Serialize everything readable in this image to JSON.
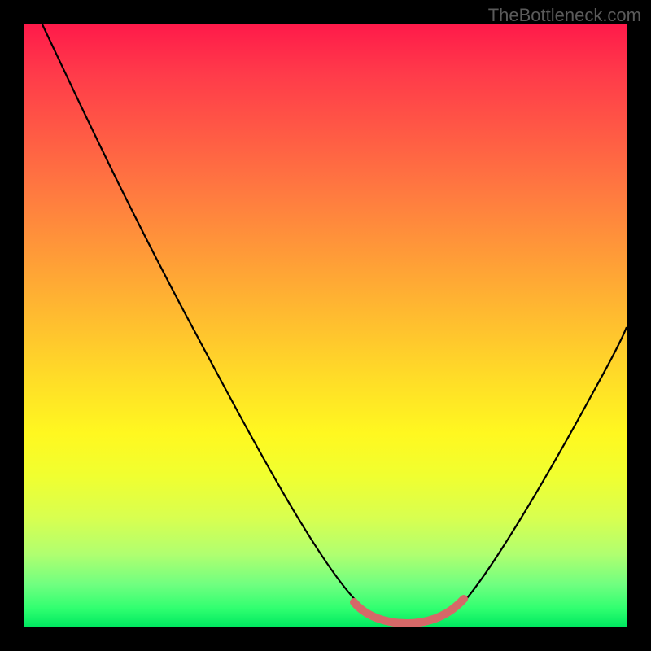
{
  "watermark": "TheBottleneck.com",
  "chart_data": {
    "type": "line",
    "title": "",
    "xlabel": "",
    "ylabel": "",
    "xlim": [
      0,
      100
    ],
    "ylim": [
      0,
      100
    ],
    "grid": false,
    "legend": false,
    "series": [
      {
        "name": "curve",
        "x": [
          3,
          10,
          20,
          30,
          40,
          50,
          55,
          58,
          60,
          63,
          66,
          70,
          73,
          78,
          85,
          92,
          100
        ],
        "y": [
          99,
          87,
          69,
          51,
          33,
          15,
          7,
          3,
          1,
          0,
          0,
          1,
          4,
          10,
          22,
          36,
          53
        ]
      }
    ],
    "accent_region": {
      "name": "highlighted-range",
      "x_start": 55,
      "x_end": 73,
      "color": "#d66868"
    },
    "gradient_stops": [
      {
        "pos": 0,
        "color": "#ff1a4a"
      },
      {
        "pos": 50,
        "color": "#ffda28"
      },
      {
        "pos": 100,
        "color": "#00e860"
      }
    ]
  }
}
